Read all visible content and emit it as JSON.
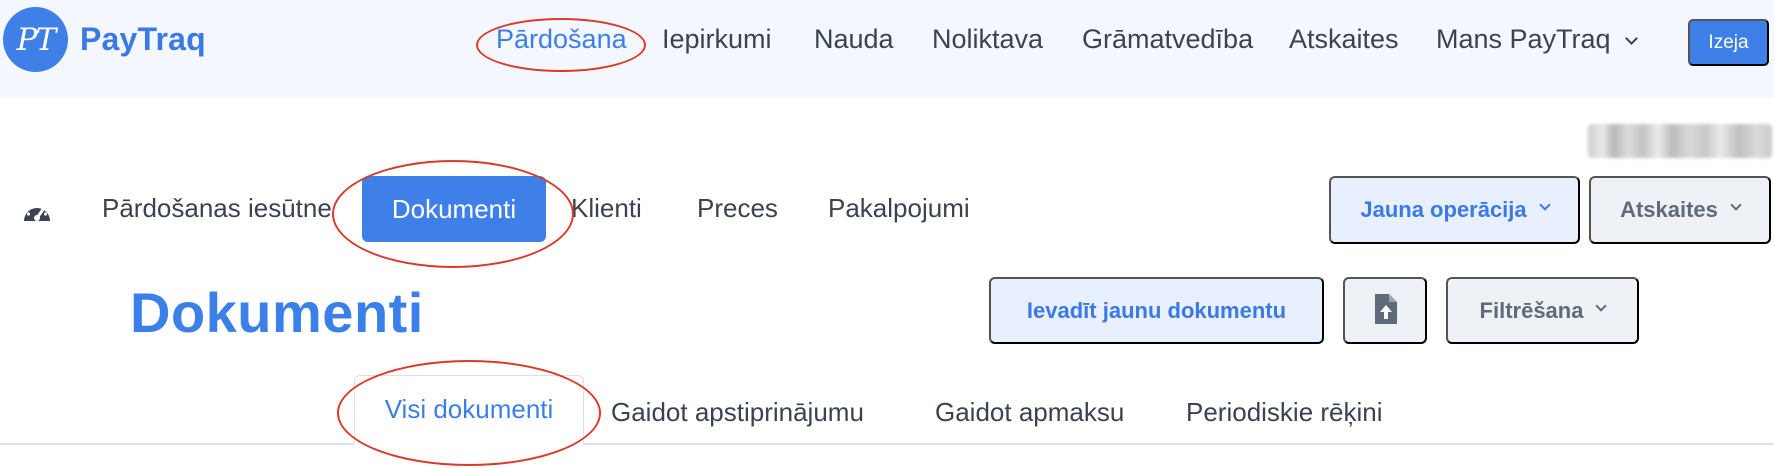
{
  "brand": {
    "logo_mark": "PT",
    "name": "PayTraq",
    "color": "#3b79e6"
  },
  "top_nav": {
    "items": [
      {
        "label": "Pārdošana",
        "active": true
      },
      {
        "label": "Iepirkumi"
      },
      {
        "label": "Nauda"
      },
      {
        "label": "Noliktava"
      },
      {
        "label": "Grāmatvedība"
      },
      {
        "label": "Atskaites"
      },
      {
        "label": "Mans PayTraq",
        "dropdown": true
      }
    ],
    "exit_label": "Izeja"
  },
  "sub_nav": {
    "dashboard_icon": "speedometer-icon",
    "items": [
      {
        "label": "Pārdošanas iesūtne"
      },
      {
        "label": "Dokumenti",
        "active": true
      },
      {
        "label": "Klienti"
      },
      {
        "label": "Preces"
      },
      {
        "label": "Pakalpojumi"
      }
    ],
    "new_operation_label": "Jauna operācija",
    "reports_label": "Atskaites"
  },
  "page": {
    "title": "Dokumenti",
    "new_document_label": "Ievadīt jaunu dokumentu",
    "upload_icon": "file-upload-icon",
    "filter_label": "Filtrēšana"
  },
  "tabs": [
    {
      "label": "Visi dokumenti",
      "active": true
    },
    {
      "label": "Gaidot apstiprinājumu"
    },
    {
      "label": "Gaidot apmaksu"
    },
    {
      "label": "Periodiskie rēķini"
    }
  ],
  "colors": {
    "accent": "#3f7fe8",
    "annotation": "#d93a2b",
    "topbar_bg": "#f4f7fd"
  }
}
